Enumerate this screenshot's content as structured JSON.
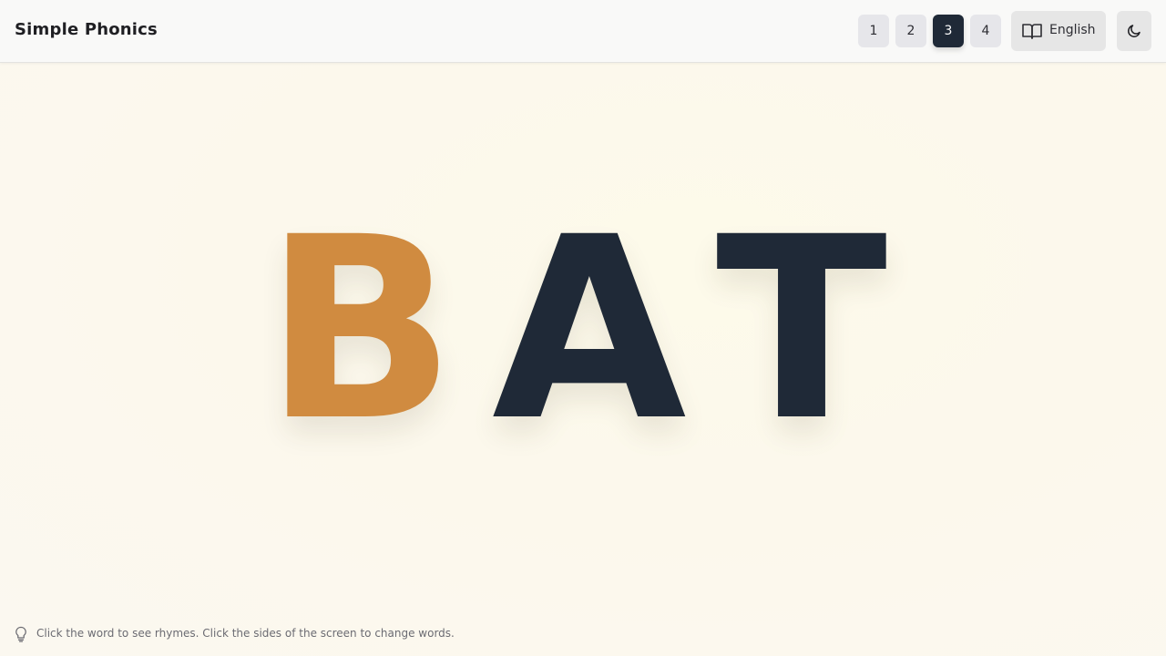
{
  "header": {
    "title": "Simple Phonics",
    "levels": [
      "1",
      "2",
      "3",
      "4"
    ],
    "active_level": "3",
    "language": {
      "label": "English",
      "icon": "book-open-icon"
    },
    "theme_toggle": {
      "icon": "moon-icon"
    }
  },
  "word": {
    "letters": [
      {
        "char": "B",
        "color": "#d08b40"
      },
      {
        "char": "A",
        "color": "#1f2937"
      },
      {
        "char": "T",
        "color": "#1f2937"
      }
    ]
  },
  "hint": {
    "icon": "lightbulb-icon",
    "text": "Click the word to see rhymes. Click the sides of the screen to change words."
  }
}
